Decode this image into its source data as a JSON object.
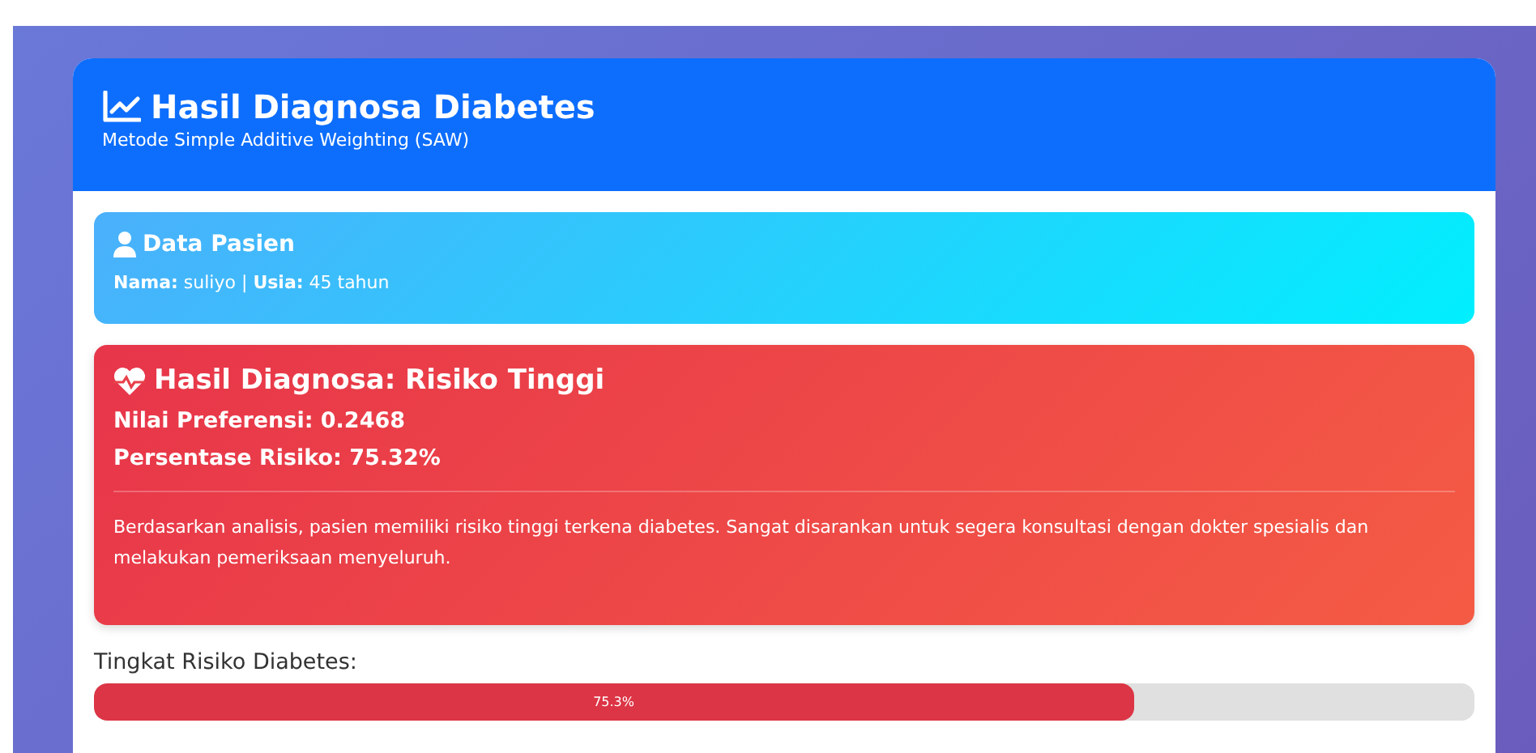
{
  "header": {
    "title": "Hasil Diagnosa Diabetes",
    "subtitle": "Metode Simple Additive Weighting (SAW)"
  },
  "patient": {
    "title": "Data Pasien",
    "details": "**Nama:** suliyo | **Usia:** 45 tahun"
  },
  "result": {
    "kind": "high",
    "title": "Hasil Diagnosa: Risiko Tinggi",
    "preference": "Nilai Preferensi: 0.2468",
    "percentage": "Persentase Risiko: 75.32%",
    "advice": "Berdasarkan analisis, pasien memiliki risiko tinggi terkena diabetes. Sangat disarankan untuk segera konsultasi dengan dokter spesialis dan melakukan pemeriksaan menyeluruh."
  },
  "risk_meter": {
    "label": "Tingkat Risiko Diabetes:",
    "level": 0.753,
    "reading": "75.3%"
  }
}
